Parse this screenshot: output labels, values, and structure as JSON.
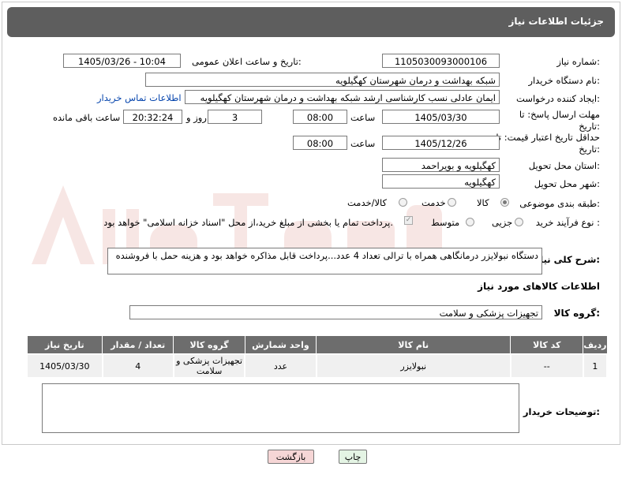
{
  "header": {
    "title": "جزئیات اطلاعات نیاز"
  },
  "fields": {
    "need_number_label": "شماره نیاز:",
    "need_number": "1105030093000106",
    "announce_label": "تاریخ و ساعت اعلان عمومی:",
    "announce_value": "1405/03/26 - 10:04",
    "buyer_org_label": "نام دستگاه خریدار:",
    "buyer_org": "شبکه بهداشت و درمان شهرستان کهگیلویه",
    "creator_label": "ایجاد کننده درخواست:",
    "creator": "ایمان عادلی نسب کارشناسی ارشد شبکه بهداشت و درمان شهرستان کهگیلویه",
    "buyer_contact_link": "اطلاعات تماس خریدار",
    "reply_deadline_label": "مهلت ارسال پاسخ: تا تاریخ:",
    "reply_date": "1405/03/30",
    "time_label": "ساعت",
    "reply_time": "08:00",
    "days_value": "3",
    "days_label": "روز و",
    "remaining_time": "20:32:24",
    "remaining_label": "ساعت باقی مانده",
    "price_validity_label": "حداقل تاریخ اعتبار قیمت: تا تاریخ:",
    "price_date": "1405/12/26",
    "price_time": "08:00",
    "province_label": "استان محل تحویل:",
    "province": "کهگیلویه و بویراحمد",
    "city_label": "شهر محل تحویل:",
    "city": "کهگیلویه",
    "category_label": "طبقه بندی موضوعی:",
    "category_options": [
      "کالا",
      "خدمت",
      "کالا/خدمت"
    ],
    "process_label": "نوع فرآیند خرید :",
    "process_options": [
      "جزیی",
      "متوسط"
    ],
    "payment_note": "پرداخت تمام یا بخشی از مبلغ خرید،از محل \"اسناد خزانه اسلامی\" خواهد بود."
  },
  "description": {
    "label": "شرح کلی نیاز:",
    "text": "دستگاه نبولایزر درمانگاهی  همراه با ترالی تعداد 4 عدد...پرداخت قابل مذاکره خواهد بود و هزینه حمل با فروشنده"
  },
  "goods": {
    "section_title": "اطلاعات کالاهای مورد نیاز",
    "group_label": "گروه کالا:",
    "group_value": "تجهیزات پزشکی و سلامت",
    "columns": [
      "ردیف",
      "کد کالا",
      "نام کالا",
      "واحد شمارش",
      "گروه کالا",
      "تعداد / مقدار",
      "تاریخ نیاز"
    ],
    "rows": [
      [
        "1",
        "--",
        "نبولایزر",
        "عدد",
        "تجهیزات پزشکی و سلامت",
        "4",
        "1405/03/30"
      ]
    ]
  },
  "buyer_notes_label": "توضیحات خریدار:",
  "buttons": {
    "print": "چاپ",
    "back": "بازگشت"
  },
  "colors": {
    "header_bg": "#5e5e5e",
    "table_header_bg": "#6d6d6d",
    "back_button_bg": "#f6d6d6",
    "print_button_bg": "#e4f4e4"
  }
}
